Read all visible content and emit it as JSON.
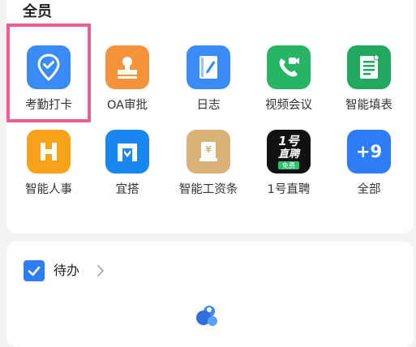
{
  "section": {
    "title": "全员"
  },
  "apps": [
    {
      "label": "考勤打卡",
      "icon": "location-check-icon",
      "color": "#3a8bf5"
    },
    {
      "label": "OA审批",
      "icon": "approval-stamp-icon",
      "color": "#f4933a"
    },
    {
      "label": "日志",
      "icon": "journal-pen-icon",
      "color": "#3a8bf5"
    },
    {
      "label": "视频会议",
      "icon": "video-call-icon",
      "color": "#27b565"
    },
    {
      "label": "智能填表",
      "icon": "form-list-icon",
      "color": "#22a85f"
    },
    {
      "label": "智能人事",
      "icon": "hr-h-icon",
      "color": "#f7a21b"
    },
    {
      "label": "宜搭",
      "icon": "yida-icon",
      "color": "#1a87f0"
    },
    {
      "label": "智能工资条",
      "icon": "salary-slip-icon",
      "color": "#d9b27a"
    },
    {
      "label": "1号直聘",
      "icon": "hire-logo-icon",
      "color": "#111111",
      "logo_text": "1号",
      "logo_sub": "直聘",
      "logo_badge": "免费"
    },
    {
      "label": "全部",
      "icon": "more-apps-icon",
      "color": "#2f7df6",
      "count_text": "+9"
    }
  ],
  "todo": {
    "label": "待办",
    "checked": true
  }
}
